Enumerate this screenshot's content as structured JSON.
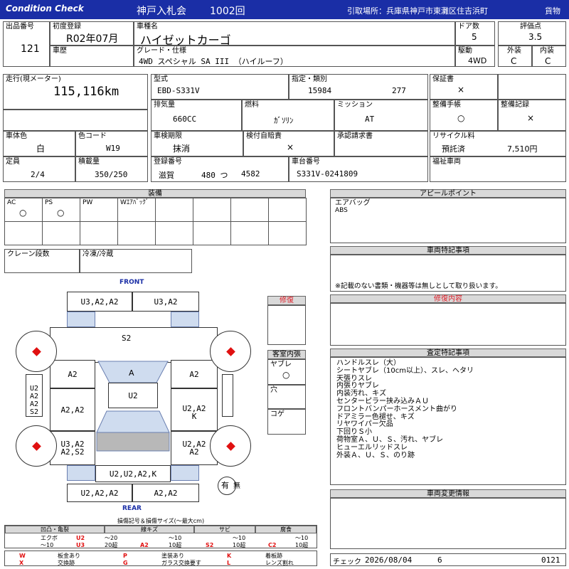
{
  "header": {
    "condition": "Condition  Check",
    "auction": "神戸入札会",
    "auction_no": "1002回",
    "pickup": "引取場所：兵庫県神戸市東灘区住吉浜町",
    "category": "貨物"
  },
  "top": {
    "lot_no_label": "出品番号",
    "lot_no": "121",
    "first_reg_label": "初度登録",
    "first_reg": "R02年07月",
    "car_name_label": "車種名",
    "car_name": "ハイゼットカーゴ",
    "doors_label": "ドア数",
    "doors": "5",
    "score_label": "評価点",
    "score": "3.5",
    "history_label": "車歴",
    "grade_label": "グレード・仕様",
    "grade": "4WD  スペシャル  SA  III  （ハイルーフ）",
    "drive_label": "駆動",
    "drive": "4WD",
    "ext_label": "外装",
    "ext": "C",
    "int_label": "内装",
    "int": "C"
  },
  "spec": {
    "mileage_label": "走行(現メーター)",
    "mileage": "115,116km",
    "model_label": "型式",
    "model": "EBD-S331V",
    "designation_label": "指定・類別",
    "designation": "15984",
    "category_no": "277",
    "warranty_label": "保証書",
    "warranty": "×",
    "displacement_label": "排気量",
    "displacement": "660CC",
    "fuel_label": "燃料",
    "fuel": "ｶﾞｿﾘﾝ",
    "mission_label": "ミッション",
    "mission": "AT",
    "maint_label": "整備手帳",
    "maint": "○",
    "maint_rec_label": "整備記録",
    "maint_rec": "×",
    "body_color_label": "車体色",
    "body_color": "白",
    "color_code_label": "色コード",
    "color_code": "W19",
    "inspect_label": "車検期限",
    "inspect": "抹消",
    "liability_label": "検付自賠責",
    "liability": "×",
    "approval_label": "承認請求書",
    "recycle_label": "リサイクル料",
    "recycle_status": "預託済",
    "recycle_fee": "7,510円",
    "capacity_label": "定員",
    "capacity": "2/4",
    "load_label": "積載量",
    "load": "350/250",
    "reg_no_label": "登録番号",
    "reg_area": "滋賀",
    "reg_class": "480 つ",
    "reg_num": "4582",
    "chassis_label": "車台番号",
    "chassis": "S331V-0241809",
    "welfare_label": "福祉車両"
  },
  "equipment": {
    "title": "装備",
    "items": [
      {
        "label": "AC",
        "mark": "○"
      },
      {
        "label": "PS",
        "mark": "○"
      },
      {
        "label": "PW",
        "mark": ""
      },
      {
        "label": "Wｴｱﾊﾞｯｸﾞ",
        "mark": ""
      }
    ],
    "crane_label": "クレーン段数",
    "freezer_label": "冷凍/冷蔵"
  },
  "appeal": {
    "title": "アピールポイント",
    "lines": [
      "エアバッグ",
      "ABS"
    ]
  },
  "special_notes": {
    "title": "車両特記事項",
    "note": "※記載のない書類・機器等は無しとして取り扱います。"
  },
  "repair_content": {
    "title": "修復内容"
  },
  "inspection": {
    "title": "査定特記事項",
    "lines": [
      "ハンドルスレ（大）",
      "シートヤブレ（10cm以上）、スレ、ヘタリ",
      "天張りスレ",
      "内張りヤブレ",
      "内装汚れ、キズ",
      "センターピラー挟み込みＡＵ",
      "フロントバンパーホースメント曲がり",
      "ドアミラー色褪せ、キズ",
      "リヤワイパー欠品",
      "下回りＳ小",
      "荷物室Ａ、Ｕ、Ｓ、汚れ、ヤブレ",
      "ヒューエルリッドスレ",
      "外装Ａ、Ｕ、Ｓ、のり跡"
    ]
  },
  "change_info": {
    "title": "車両変更情報"
  },
  "check": {
    "label": "チェック",
    "date": "2026/08/04",
    "num": "6",
    "code": "0121"
  },
  "diagram": {
    "front": "FRONT",
    "rear": "REAR",
    "panels": {
      "front_bumper_l": "U3,A2,A2",
      "front_bumper_r": "U3,A2",
      "hood": "S2",
      "fender_l": "A2",
      "windshield": "A",
      "fender_r": "A2",
      "roof": "U2",
      "door_fl": "A2,A2",
      "door_fr": "U2,A2\nK",
      "side_l": "U2\nA2\nA2\nS2",
      "rear_l": "U3,A2\nA2,S2",
      "rear_r": "U2,A2\nA2",
      "back_door": "U2,U2,A2,K",
      "rear_bumper_l": "U2,A2,A2",
      "rear_bumper_r": "A2,A2"
    },
    "repair_label": "修復",
    "interior_title": "客室内張",
    "interior_tear": "ヤブレ",
    "interior_tear_mark": "○",
    "interior_hole": "穴",
    "interior_burn": "コゲ",
    "spare_label": "有",
    "spare_none": "無"
  },
  "legend": {
    "title": "損傷記号＆損傷サイズ(～最大cm)",
    "groups": [
      {
        "head": "凹凸・亀裂",
        "a": "エクボ",
        "a_code": "U2",
        "a_size": "～20",
        "b_size": "～10",
        "b_code": "U3",
        "b_note": "20超"
      },
      {
        "head": "線キズ",
        "a_size": "～10",
        "a_code": "A2",
        "a_note": "10超"
      },
      {
        "head": "サビ",
        "a_size": "～10",
        "a_code": "S2",
        "a_note": "10超"
      },
      {
        "head": "腐食",
        "a_size": "～10",
        "a_code": "C2",
        "a_note": "10超"
      }
    ],
    "codes": [
      {
        "k": "W",
        "v": "板金あり"
      },
      {
        "k": "P",
        "v": "塗装あり"
      },
      {
        "k": "K",
        "v": "着板跡"
      },
      {
        "k": "X",
        "v": "交換跡"
      },
      {
        "k": "G",
        "v": "ガラス交換要す"
      },
      {
        "k": "L",
        "v": "レンズ割れ"
      }
    ]
  }
}
